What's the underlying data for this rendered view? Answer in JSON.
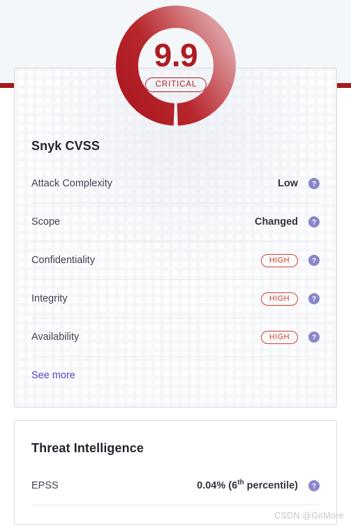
{
  "severity_ring": {
    "score": "9.9",
    "severity_label": "CRITICAL",
    "ring_color_dark": "#b01b22",
    "ring_color_light": "#d98c8f",
    "percent": 99
  },
  "accent_colors": {
    "page_background": "#f4f7f9",
    "rule_red": "#a4191b",
    "link_purple": "#5b3ec9",
    "pill_orange_red": "#d0432a",
    "help_icon_purple": "#8a86c9"
  },
  "cvss_card": {
    "title": "Snyk CVSS",
    "rows": [
      {
        "label": "Attack Complexity",
        "value": "Low",
        "type": "text",
        "help_icon": "help-circle-icon"
      },
      {
        "label": "Scope",
        "value": "Changed",
        "type": "text",
        "help_icon": "help-circle-icon"
      },
      {
        "label": "Confidentiality",
        "value": "HIGH",
        "type": "pill",
        "help_icon": "help-circle-icon"
      },
      {
        "label": "Integrity",
        "value": "HIGH",
        "type": "pill",
        "help_icon": "help-circle-icon"
      },
      {
        "label": "Availability",
        "value": "HIGH",
        "type": "pill",
        "help_icon": "help-circle-icon"
      }
    ],
    "see_more_label": "See more"
  },
  "threat_card": {
    "title": "Threat Intelligence",
    "rows": [
      {
        "label": "EPSS",
        "value_prefix": "0.04% (6",
        "value_sup": "th",
        "value_suffix": " percentile)",
        "type": "rich",
        "help_icon": "help-circle-icon"
      }
    ]
  },
  "watermark": "CSDN @GitMore"
}
